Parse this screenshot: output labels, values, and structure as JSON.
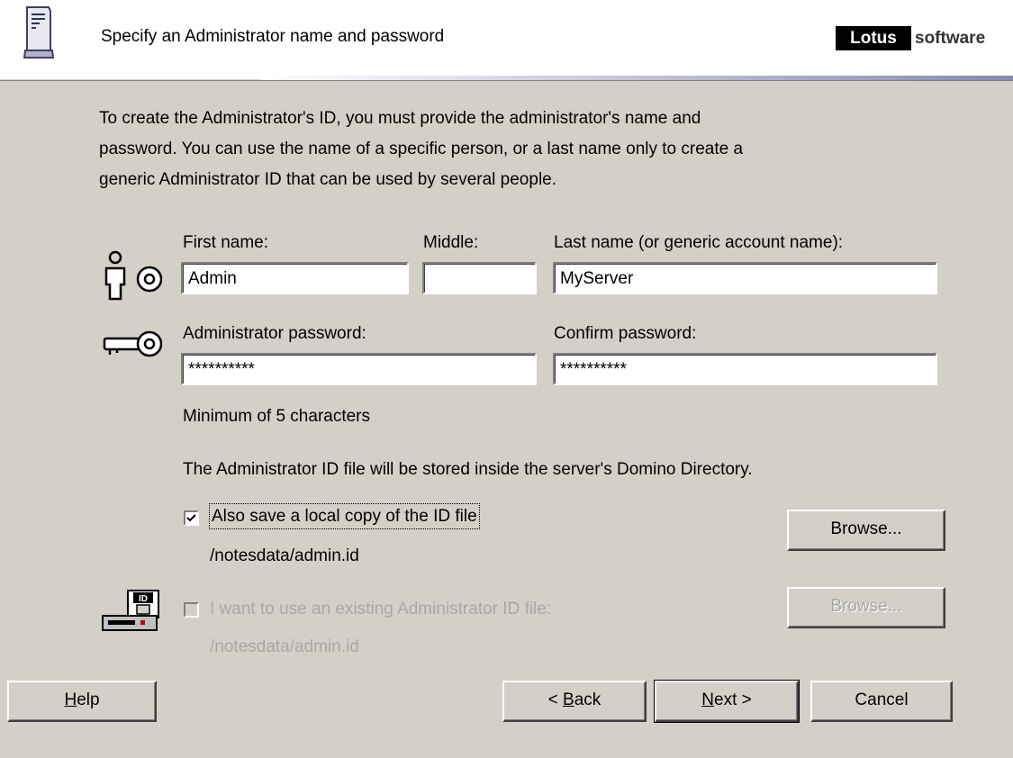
{
  "header": {
    "title": "Specify an Administrator name and password",
    "brand_box": "Lotus",
    "brand_text": "software"
  },
  "intro": [
    "To create the Administrator's ID, you must provide the administrator's name and",
    "password. You can use the name of a specific person, or a last name only to create a",
    "generic Administrator ID that can be used by several people."
  ],
  "name_fields": {
    "first_label": "First name:",
    "first_value": "Admin",
    "middle_label": "Middle:",
    "middle_value": "",
    "last_label": "Last name (or generic account name):",
    "last_value": "MyServer"
  },
  "password_fields": {
    "password_label": "Administrator password:",
    "password_value": "**********",
    "confirm_label": "Confirm password:",
    "confirm_value": "**********",
    "hint": "Minimum of 5 characters"
  },
  "id_file": {
    "info": "The Administrator ID file will be stored inside the server's Domino Directory.",
    "save_local_label": "Also save a local copy of the ID file",
    "save_local_checked": true,
    "save_local_path": "/notesdata/admin.id",
    "browse_label": "Browse...",
    "existing_label": "I want to use an existing Administrator ID file:",
    "existing_checked": false,
    "existing_path": "/notesdata/admin.id",
    "browse_disabled_label": "Browse..."
  },
  "footer": {
    "help_mnemonic": "H",
    "help_rest": "elp",
    "back_prefix": "< ",
    "back_mnemonic": "B",
    "back_rest": "ack",
    "next_mnemonic": "N",
    "next_rest": "ext >",
    "cancel_label": "Cancel"
  },
  "icons": {
    "server": "server-icon",
    "person_key": "person-key-icon",
    "key": "key-icon",
    "id_disk": "id-disk-icon",
    "checkmark": "checkmark-icon"
  }
}
